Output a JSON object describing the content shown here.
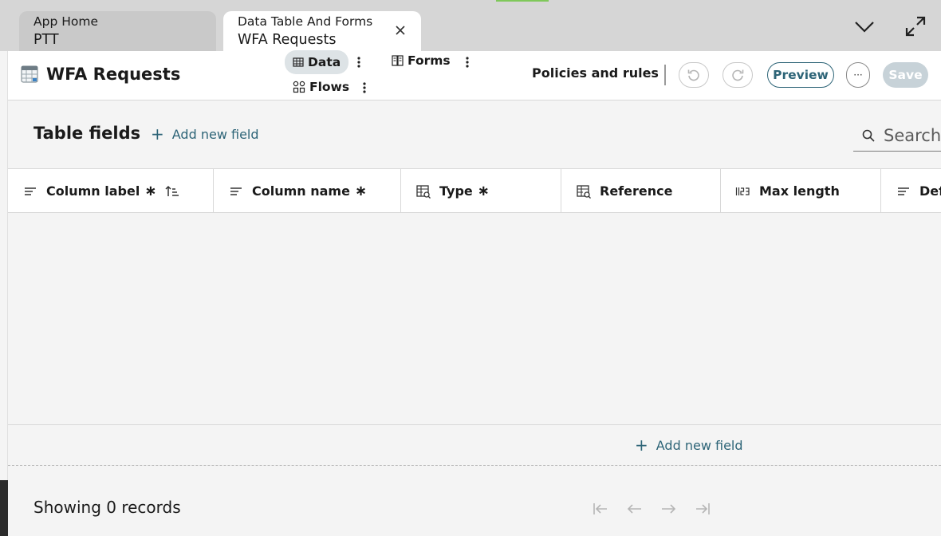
{
  "tabs": [
    {
      "title": "App Home",
      "subtitle": "PTT",
      "active": false
    },
    {
      "title": "Data Table And Forms",
      "subtitle": "WFA Requests",
      "active": true
    }
  ],
  "header": {
    "title": "WFA Requests",
    "icon": "table-icon",
    "nav": {
      "data_label": "Data",
      "forms_label": "Forms",
      "flows_label": "Flows"
    },
    "policies_label": "Policies and rules",
    "preview_label": "Preview",
    "more_label": "···",
    "save_label": "Save"
  },
  "section": {
    "title": "Table fields",
    "add_field_label": "Add new field",
    "search_placeholder": "Search"
  },
  "table": {
    "columns": [
      {
        "label": "Column label",
        "icon": "text-lines-icon",
        "required": true,
        "sorted": "asc"
      },
      {
        "label": "Column name",
        "icon": "text-lines-icon",
        "required": true
      },
      {
        "label": "Type",
        "icon": "table-search-icon",
        "required": true
      },
      {
        "label": "Reference",
        "icon": "table-search-icon",
        "required": false
      },
      {
        "label": "Max length",
        "icon": "number-icon",
        "required": false
      },
      {
        "label": "Def",
        "icon": "text-lines-icon",
        "required": false
      }
    ],
    "required_mark": "∗",
    "rows": [],
    "footer_add_label": "Add new field"
  },
  "pager": {
    "records_label": "Showing 0 records"
  },
  "colors": {
    "accent": "#2d6477",
    "save_disabled": "#c7d2d8",
    "selected_nav": "#dde3e6",
    "tab_strip": "#d6d6d6"
  }
}
